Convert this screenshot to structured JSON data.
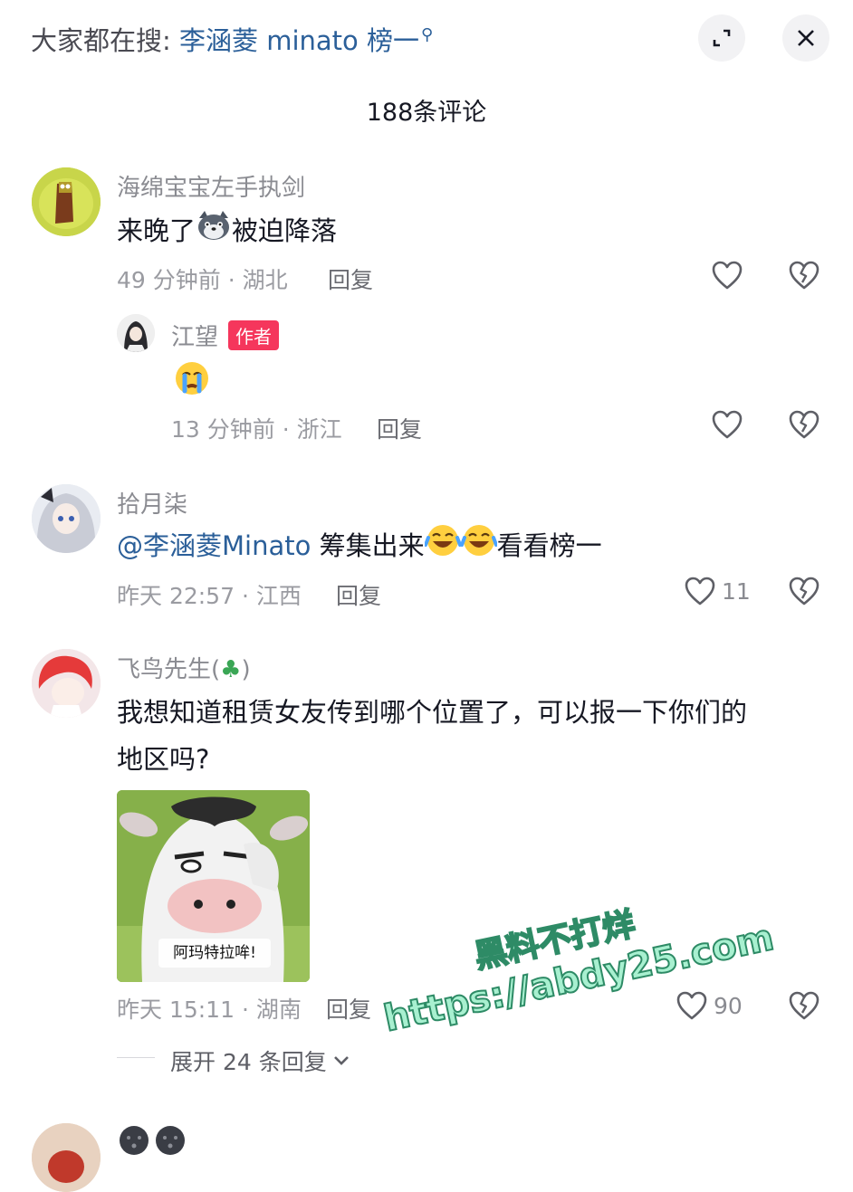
{
  "header": {
    "search_prefix": "大家都在搜: ",
    "search_keyword": "李涵菱 minato 榜一",
    "comment_count": "188条评论"
  },
  "comments": [
    {
      "username": "海绵宝宝左手执剑",
      "text_before": "来晚了",
      "text_after": "被迫降落",
      "time_location": "49 分钟前 · 湖北",
      "reply_label": "回复"
    },
    {
      "username": "江望",
      "badge": "作者",
      "time_location": "13 分钟前 · 浙江",
      "reply_label": "回复"
    },
    {
      "username": "拾月柒",
      "mention": "@李涵菱Minato",
      "text": "筹集出来",
      "text_after": "看看榜一",
      "time_location": "昨天 22:57 · 江西",
      "reply_label": "回复",
      "likes": "11"
    },
    {
      "username": "飞鸟先生(",
      "username_suffix": ")",
      "text_line1": "我想知道租赁女友传到哪个位置了，可以报一下你们的",
      "text_line2": "地区吗?",
      "sticker_text": "阿玛特拉哞!",
      "time_location": "昨天 15:11 · 湖南",
      "reply_label": "回复",
      "likes": "90",
      "expand_label": "展开 24 条回复"
    }
  ],
  "watermark": {
    "line1": "黑料不打烊",
    "line2": "https://abdy25.com"
  },
  "colors": {
    "mention": "#2b5f99",
    "author_badge": "#f5365c",
    "watermark_fill": "#a8f0d0"
  }
}
